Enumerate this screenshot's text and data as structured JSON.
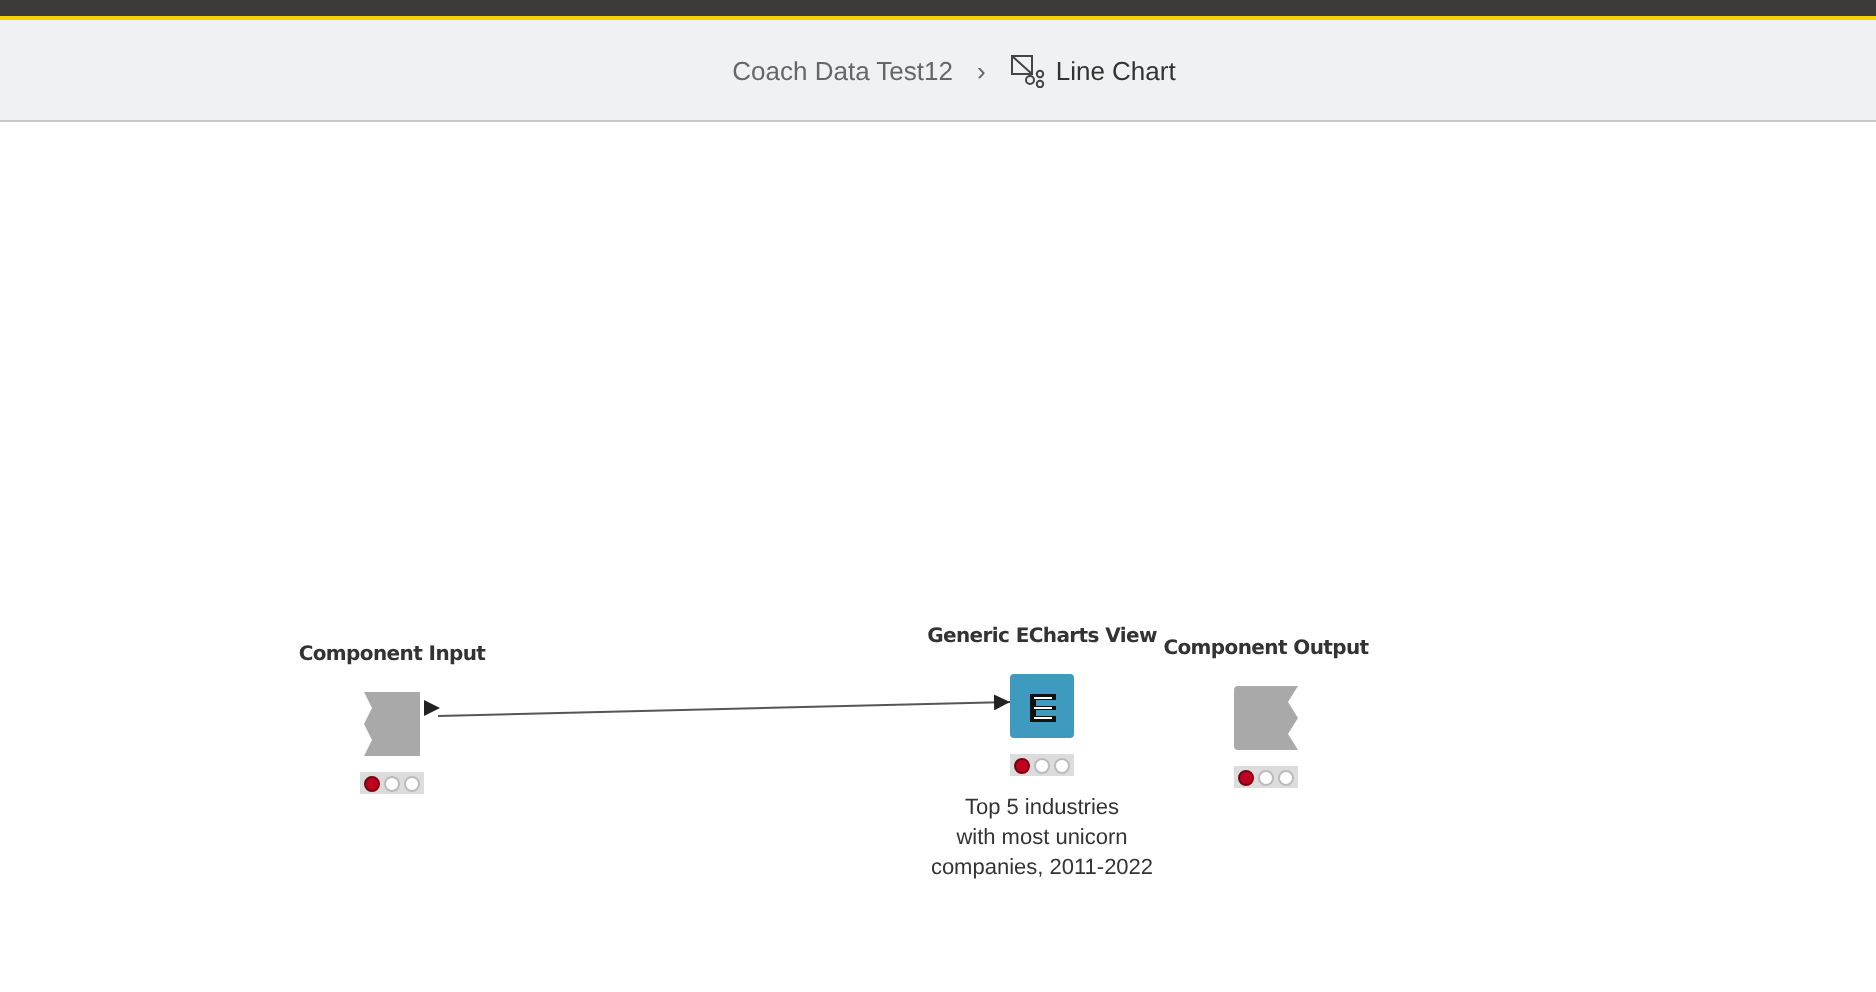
{
  "breadcrumb": [
    {
      "label": "Coach Data Test12",
      "kind": "parent"
    },
    {
      "label": "›",
      "kind": "separator"
    },
    {
      "label": "Line Chart",
      "kind": "current"
    }
  ],
  "nodes": [
    {
      "kind": "input",
      "name": "Component Input",
      "lights": [
        {
          "on": true
        },
        {
          "on": false
        },
        {
          "on": false
        }
      ]
    },
    {
      "kind": "view",
      "name": "Generic ECharts View",
      "lights": [
        {
          "on": true
        },
        {
          "on": false
        },
        {
          "on": false
        }
      ],
      "description": "Top 5 industries\nwith most unicorn\ncompanies, 2011-2022"
    },
    {
      "kind": "output",
      "name": "Component Output",
      "lights": [
        {
          "on": true
        },
        {
          "on": false
        },
        {
          "on": false
        }
      ]
    }
  ]
}
